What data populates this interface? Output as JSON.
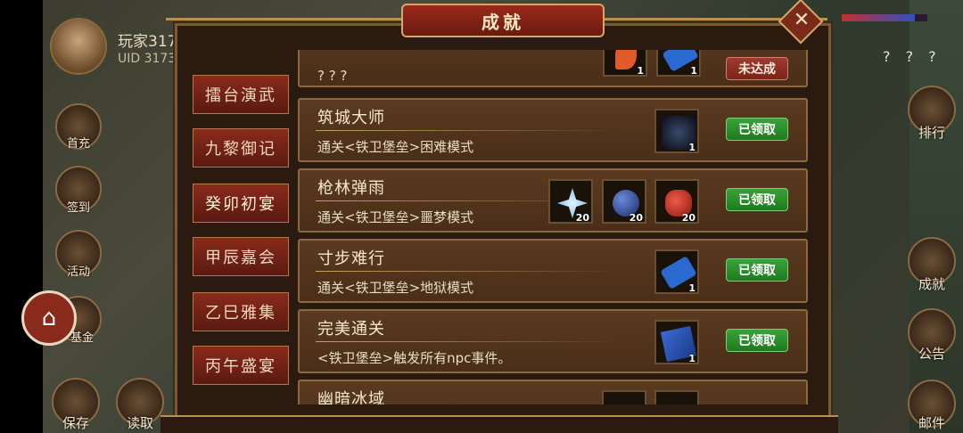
{
  "player": {
    "name": "玩家317",
    "uid": "UID 3173"
  },
  "header": {
    "title": "成就",
    "close_icon": "close-icon",
    "hp_fraction": 0.85
  },
  "side_menu": {
    "items": [
      {
        "label": "首充",
        "icon": "first-charge-icon"
      },
      {
        "label": "签到",
        "icon": "signin-icon"
      },
      {
        "label": "活动",
        "icon": "activity-icon"
      },
      {
        "label": "基金",
        "icon": "fund-icon"
      }
    ]
  },
  "right_menu": {
    "question_marks": "? ? ?",
    "items": [
      {
        "label": "排行",
        "icon": "ranking-icon"
      },
      {
        "label": "成就",
        "icon": "achievement-icon"
      },
      {
        "label": "公告",
        "icon": "notice-icon"
      },
      {
        "label": "邮件",
        "icon": "mail-icon"
      }
    ]
  },
  "bottom_menu": {
    "items": [
      {
        "label": "保存",
        "icon": "save-icon"
      },
      {
        "label": "读取",
        "icon": "load-icon"
      }
    ]
  },
  "tabs": [
    {
      "label": "擂台演武"
    },
    {
      "label": "九黎御记"
    },
    {
      "label": "癸卯初宴"
    },
    {
      "label": "甲辰嘉会"
    },
    {
      "label": "乙巳雅集"
    },
    {
      "label": "丙午盛宴"
    }
  ],
  "achievements": [
    {
      "title": "",
      "desc": "? ? ?",
      "status": "未达成",
      "items": [
        {
          "icon": "feather-icon",
          "count": "1"
        },
        {
          "icon": "scroll-icon",
          "count": "1"
        }
      ]
    },
    {
      "title": "筑城大师",
      "desc": "通关<铁卫堡垒>困难模式",
      "status": "已领取",
      "items": [
        {
          "icon": "rider-icon",
          "count": "1"
        }
      ]
    },
    {
      "title": "枪林弹雨",
      "desc": "通关<铁卫堡垒>噩梦模式",
      "status": "已领取",
      "items": [
        {
          "icon": "crystal-icon",
          "count": "20"
        },
        {
          "icon": "fruit-icon",
          "count": "20"
        },
        {
          "icon": "glove-icon",
          "count": "20"
        }
      ]
    },
    {
      "title": "寸步难行",
      "desc": "通关<铁卫堡垒>地狱模式",
      "status": "已领取",
      "items": [
        {
          "icon": "scroll-icon",
          "count": "1"
        }
      ]
    },
    {
      "title": "完美通关",
      "desc": "<铁卫堡垒>触发所有npc事件。",
      "status": "已领取",
      "items": [
        {
          "icon": "book-icon",
          "count": "1"
        }
      ]
    },
    {
      "title": "幽暗冰域",
      "desc": "",
      "status": "",
      "items": [
        {
          "icon": "item-icon",
          "count": ""
        },
        {
          "icon": "item-icon",
          "count": ""
        }
      ]
    }
  ]
}
